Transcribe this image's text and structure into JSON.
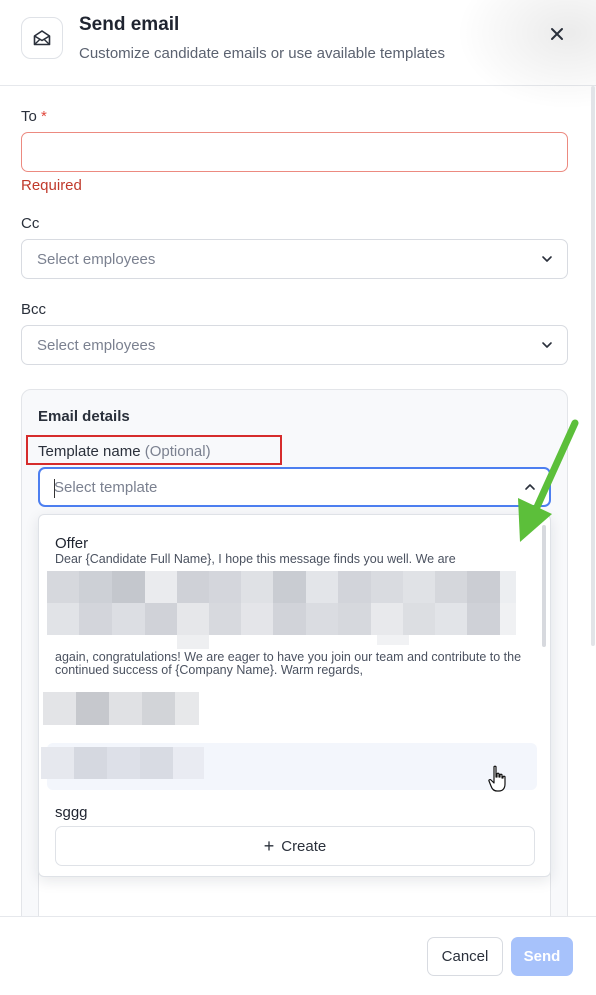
{
  "header": {
    "title": "Send email",
    "subtitle": "Customize candidate emails or use available templates",
    "icon": "envelope-open-icon",
    "close_icon": "close-icon"
  },
  "form": {
    "to": {
      "label": "To",
      "required_mark": "*",
      "value": "",
      "error": "Required"
    },
    "cc": {
      "label": "Cc",
      "placeholder": "Select employees"
    },
    "bcc": {
      "label": "Bcc",
      "placeholder": "Select employees"
    }
  },
  "email_details": {
    "title": "Email details",
    "template_label": "Template name",
    "template_optional": "(Optional)",
    "template_placeholder": "Select template",
    "dropdown": {
      "options": [
        {
          "title": "Offer",
          "preview_top": "Dear {Candidate Full Name}, I hope this message finds you well. We are",
          "preview_bottom": "again, congratulations! We are eager to have you join our team and contribute to the continued success of {Company Name}. Warm regards,"
        },
        {
          "title": "sggg"
        }
      ],
      "create_label": "Create"
    }
  },
  "footer": {
    "cancel_label": "Cancel",
    "send_label": "Send"
  },
  "colors": {
    "accent": "#4d7ff0",
    "send_disabled": "#a7c2fb",
    "error": "#c0392b",
    "highlight_box": "#d62c2c",
    "annotation_arrow": "#5cbf3a"
  }
}
